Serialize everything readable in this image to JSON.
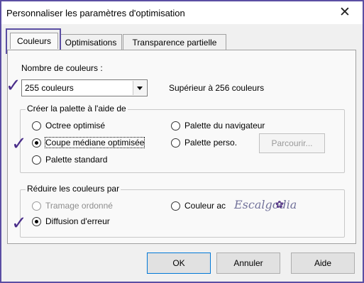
{
  "window": {
    "title": "Personnaliser les paramètres d'optimisation"
  },
  "tabs": [
    {
      "label": "Couleurs"
    },
    {
      "label": "Optimisations"
    },
    {
      "label": "Transparence partielle"
    }
  ],
  "colors_tab": {
    "count_label": "Nombre de couleurs :",
    "count_value": "255 couleurs",
    "count_note": "Supérieur à 256 couleurs",
    "palette_group": {
      "title": "Créer la palette à l'aide de",
      "options": [
        {
          "label": "Octree optimisé",
          "selected": false
        },
        {
          "label": "Coupe médiane optimisée",
          "selected": true
        },
        {
          "label": "Palette standard",
          "selected": false
        },
        {
          "label": "Palette du navigateur",
          "selected": false
        },
        {
          "label": "Palette perso.",
          "selected": false
        }
      ],
      "browse_label": "Parcourir..."
    },
    "reduce_group": {
      "title": "Réduire les couleurs par",
      "options": [
        {
          "label": "Tramage ordonné",
          "selected": false,
          "enabled": false
        },
        {
          "label": "Diffusion d'erreur",
          "selected": true,
          "enabled": true
        },
        {
          "label": "Couleur ac",
          "selected": false,
          "enabled": true
        }
      ]
    }
  },
  "watermark": {
    "text": "Escalgodia"
  },
  "buttons": {
    "ok": "OK",
    "cancel": "Annuler",
    "help": "Aide"
  },
  "annotations": {
    "checkmark": "✓"
  },
  "accent_color": "#5b4ea3"
}
